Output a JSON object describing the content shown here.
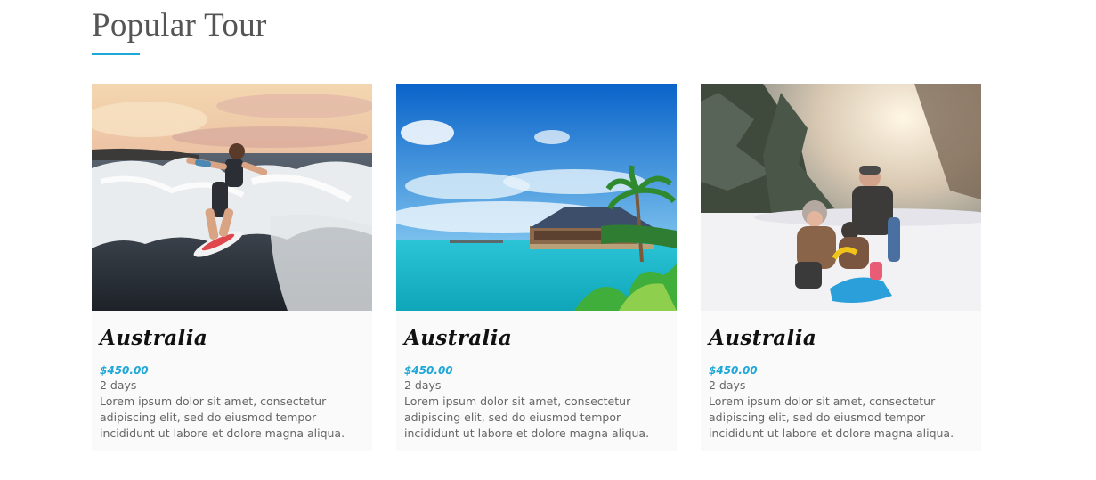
{
  "section": {
    "title": "Popular Tour"
  },
  "tours": [
    {
      "title": "Australia",
      "price": "$450.00",
      "duration": "2 days",
      "description": "Lorem ipsum dolor sit amet, consectetur adipiscing elit, sed do eiusmod tempor incididunt ut labore et dolore magna aliqua. Ut",
      "image": "surfing-photo"
    },
    {
      "title": "Australia",
      "price": "$450.00",
      "duration": "2 days",
      "description": "Lorem ipsum dolor sit amet, consectetur adipiscing elit, sed do eiusmod tempor incididunt ut labore et dolore magna aliqua. Ut",
      "image": "tropical-resort-photo"
    },
    {
      "title": "Australia",
      "price": "$450.00",
      "duration": "2 days",
      "description": "Lorem ipsum dolor sit amet, consectetur adipiscing elit, sed do eiusmod tempor incididunt ut labore et dolore magna aliqua. Ut",
      "image": "snow-family-photo"
    }
  ],
  "colors": {
    "accent": "#1ea7d7",
    "title_text": "#555555",
    "body_text": "#666666",
    "card_background": "#fafafa"
  }
}
